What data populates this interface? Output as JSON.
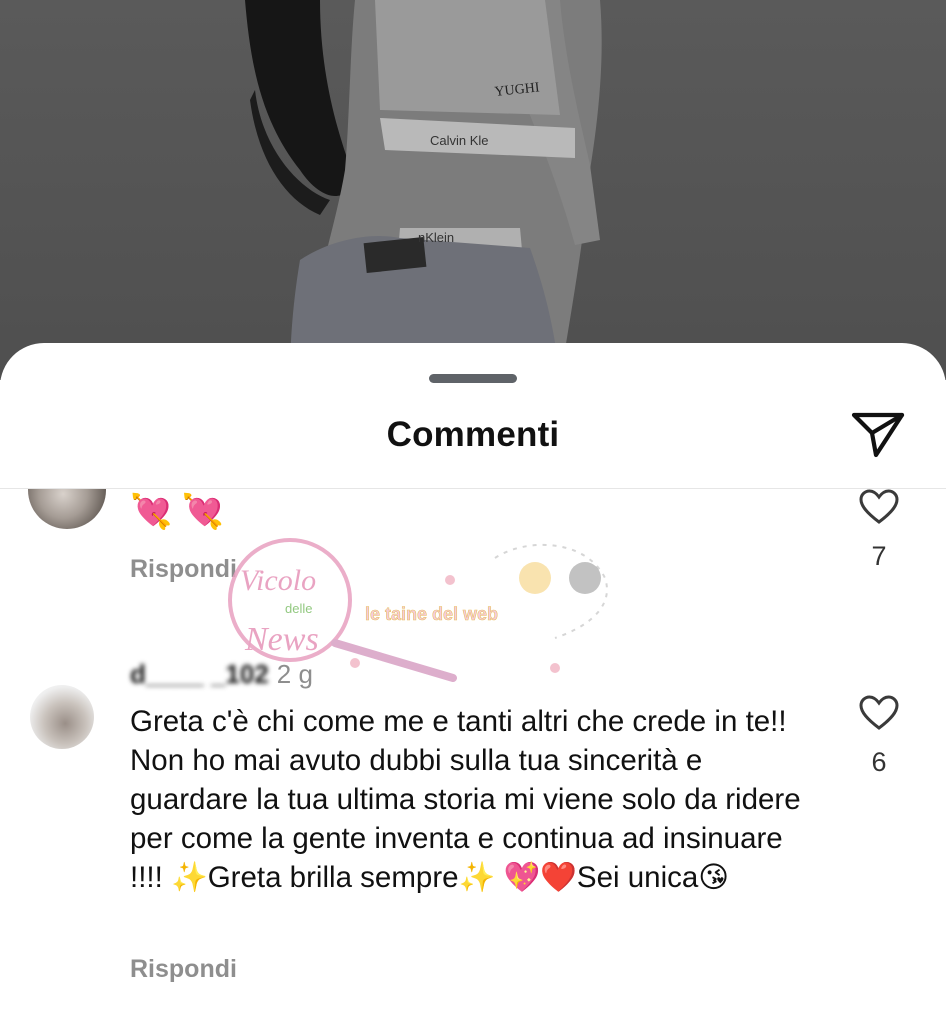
{
  "sheet": {
    "title": "Commenti",
    "share_icon": "paper-plane-icon"
  },
  "comments": [
    {
      "text": "💘 💘",
      "reply_label": "Rispondi",
      "likes": "7",
      "like_icon": "heart-outline-icon"
    },
    {
      "username": "d____ _102",
      "time": "2 g",
      "text": "Greta c'è chi come me e tanti altri che crede in te!! Non ho mai avuto dubbi sulla tua sincerità e guardare la tua ultima storia mi viene solo da ridere per come la gente inventa e continua ad insinuare !!!! ✨Greta brilla sempre✨ 💖❤️Sei unica😘",
      "reply_label": "Rispondi",
      "likes": "6",
      "like_icon": "heart-outline-icon"
    }
  ],
  "watermark": {
    "line1": "Vicolo",
    "line2": "delle",
    "line3": "News",
    "tagline": "le taine del web"
  },
  "photo_text": {
    "tattoo": "YUGHI",
    "brand_top": "Calvin Kle",
    "brand_bottom": "nKlein"
  },
  "colors": {
    "text_primary": "#111111",
    "text_secondary": "#8e8e8e",
    "sheet_bg": "#ffffff",
    "grabber": "#5f6368",
    "watermark_pink": "#e8a0c0"
  }
}
